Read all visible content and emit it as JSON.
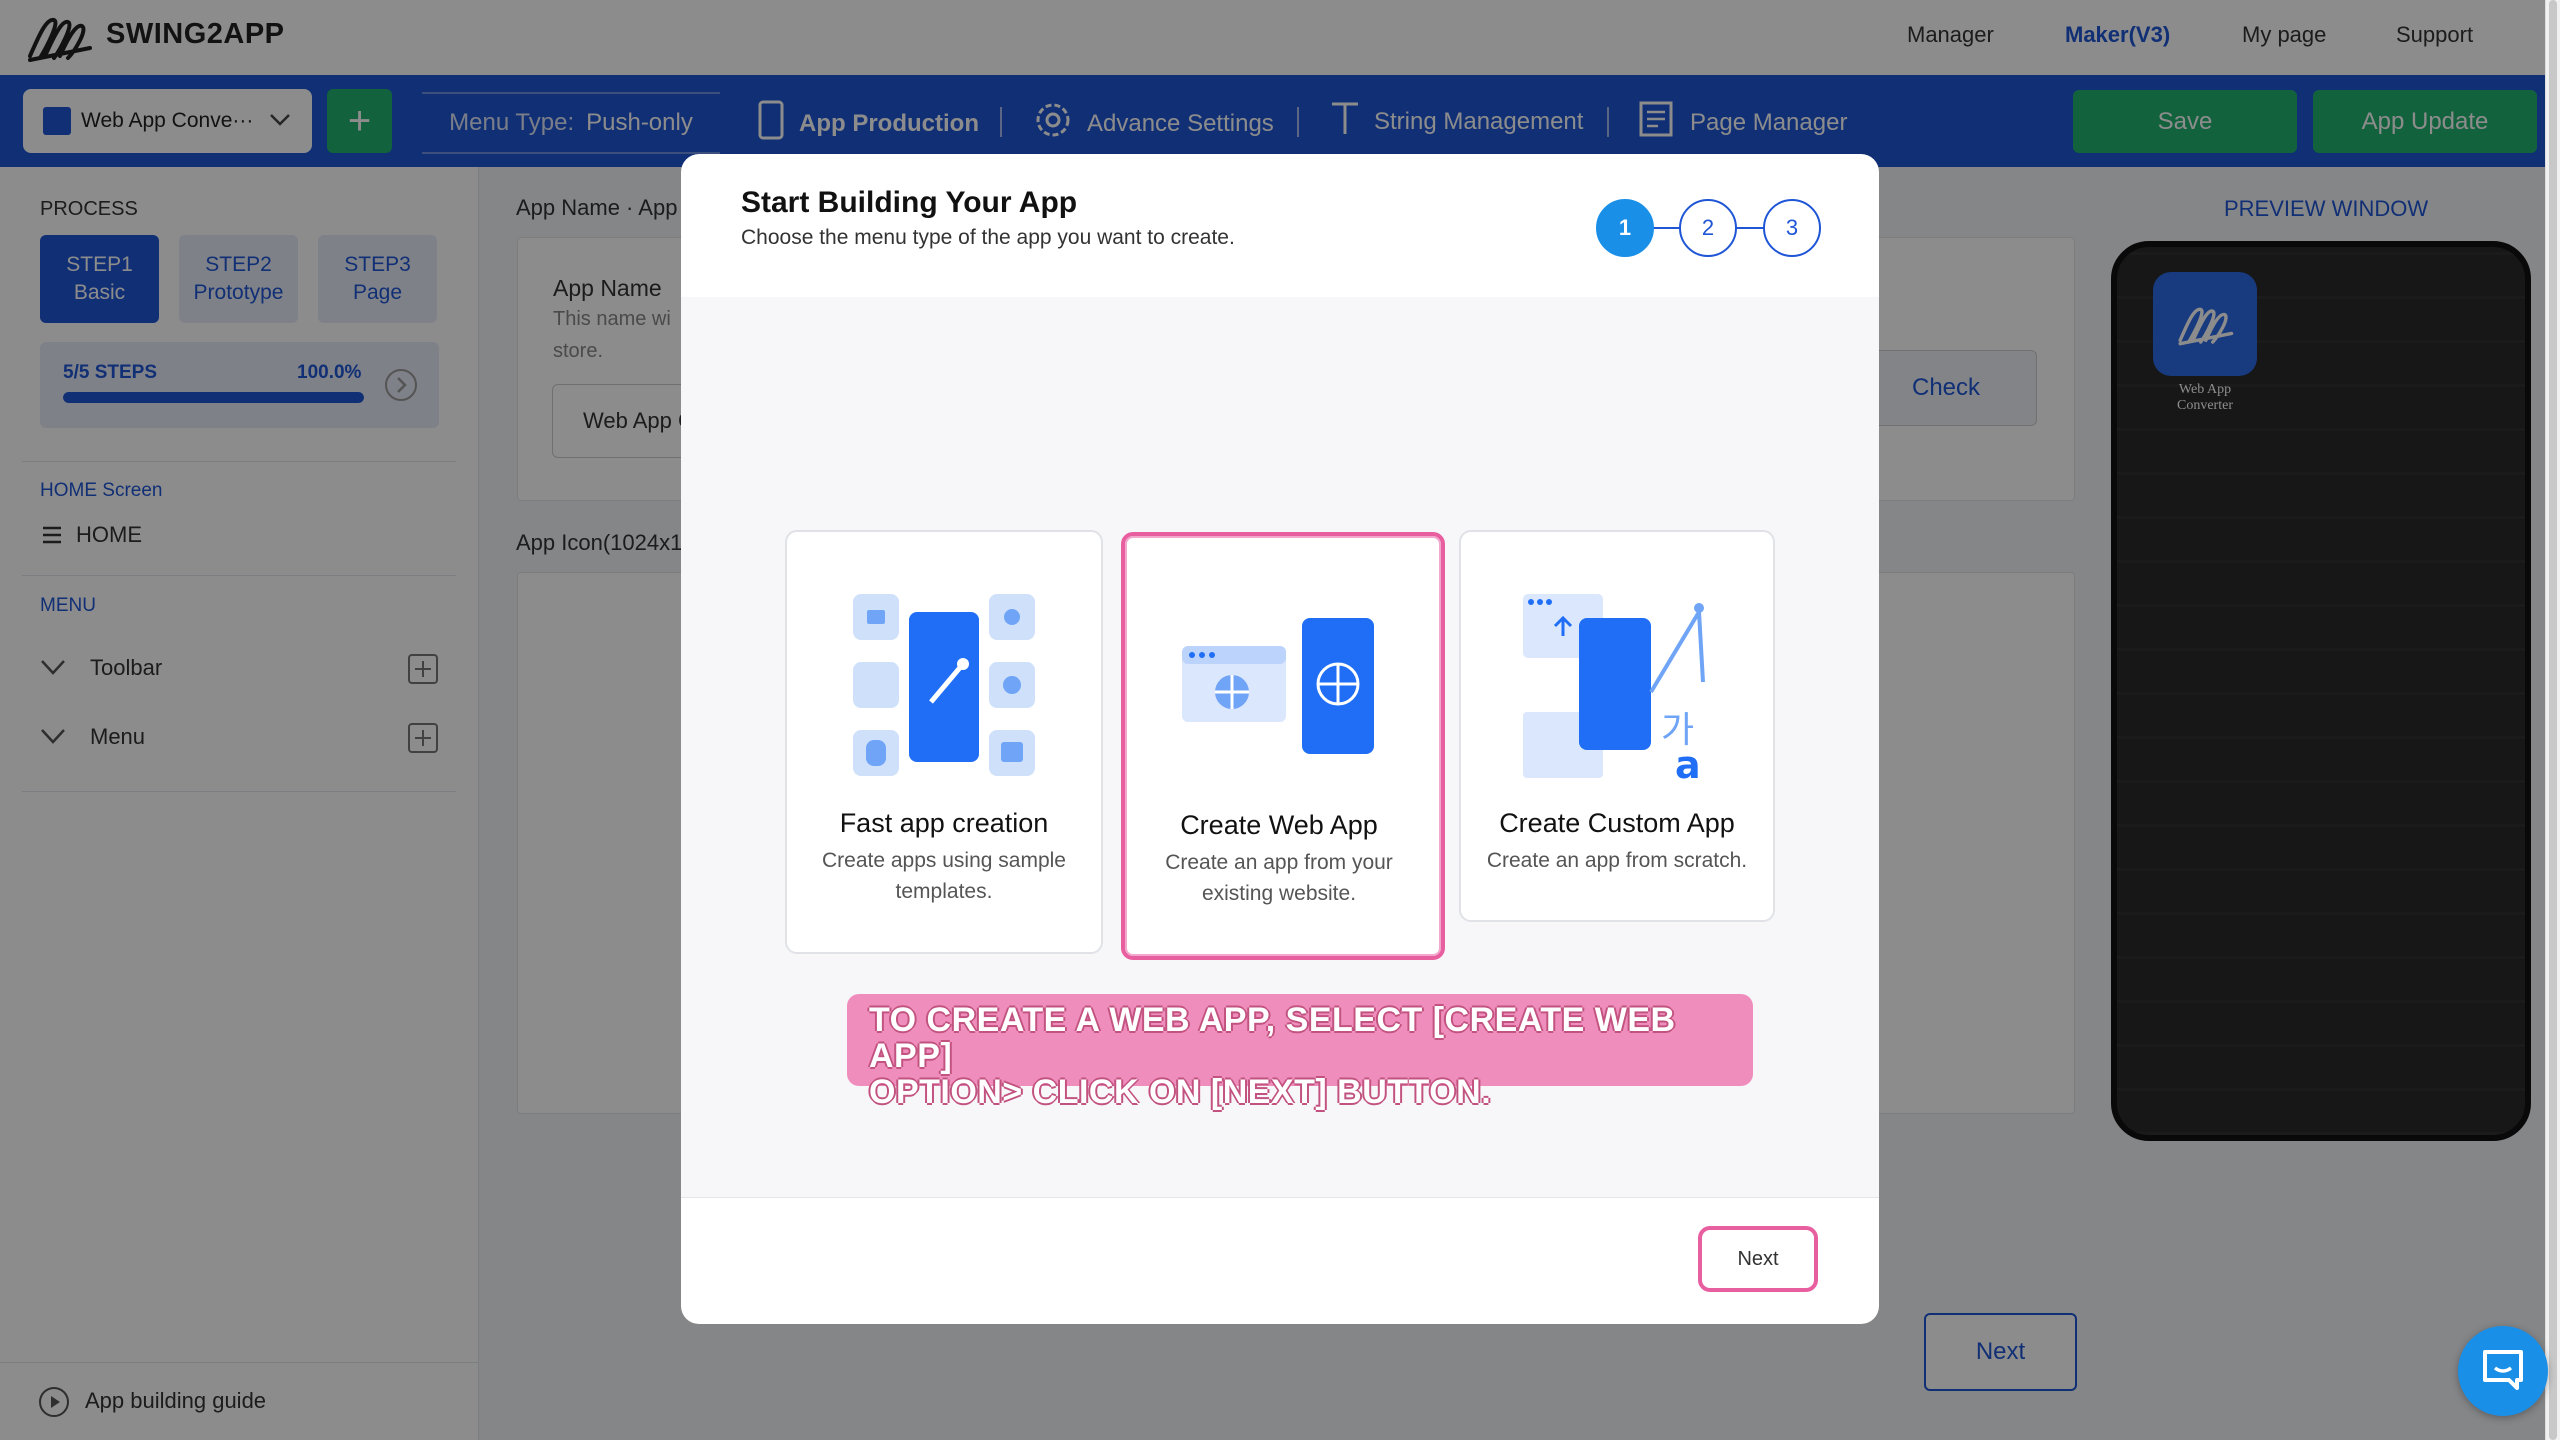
{
  "brand": {
    "name": "SWING2APP"
  },
  "topnav": {
    "items": [
      "Manager",
      "Maker(V3)",
      "My page",
      "Support"
    ],
    "active": "Maker(V3)"
  },
  "toolbar": {
    "app_select": "Web App Conve···",
    "menu_type_label": "Menu Type:",
    "menu_type_value": "Push-only",
    "tabs": [
      "App Production",
      "Advance Settings",
      "String Management",
      "Page Manager"
    ],
    "save_label": "Save",
    "update_label": "App Update"
  },
  "sidebar": {
    "process_label": "PROCESS",
    "steps": [
      {
        "num": "STEP1",
        "name": "Basic"
      },
      {
        "num": "STEP2",
        "name": "Prototype"
      },
      {
        "num": "STEP3",
        "name": "Page"
      }
    ],
    "progress": {
      "steps_text": "5/5 STEPS",
      "percent_text": "100.0%",
      "fraction": 1.0
    },
    "home_section": "HOME Screen",
    "home_item": "HOME",
    "menu_section": "MENU",
    "menu_items": [
      "Toolbar",
      "Menu"
    ],
    "guide_label": "App building guide"
  },
  "main": {
    "app_name_heading": "App Name · App",
    "app_name_label": "App Name",
    "app_name_desc_1": "This name wi",
    "app_name_desc_2": "store.",
    "app_name_value": "Web App C",
    "check_label": "Check",
    "app_icon_heading": "App Icon(1024x1",
    "next_label": "Next"
  },
  "preview": {
    "title": "PREVIEW WINDOW",
    "app_label_1": "Web App",
    "app_label_2": "Converter"
  },
  "modal": {
    "title": "Start Building Your App",
    "subtitle": "Choose the menu type of the app you want to create.",
    "steps": [
      "1",
      "2",
      "3"
    ],
    "active_step": "1",
    "options": [
      {
        "title": "Fast app creation",
        "desc_1": "Create apps using sample",
        "desc_2": "templates."
      },
      {
        "title": "Create Web App",
        "desc_1": "Create an app from your",
        "desc_2": "existing website."
      },
      {
        "title": "Create Custom App",
        "desc_1": "Create an app from scratch.",
        "desc_2": ""
      }
    ],
    "selected_option": "Create Web App",
    "callout_1": "TO CREATE A WEB APP, SELECT [CREATE WEB APP]",
    "callout_2": "OPTION> CLICK ON [NEXT]  BUTTON.",
    "next_label": "Next"
  },
  "colors": {
    "primary": "#1f56d6",
    "green": "#1fb36f",
    "highlight": "#e85fa0"
  }
}
